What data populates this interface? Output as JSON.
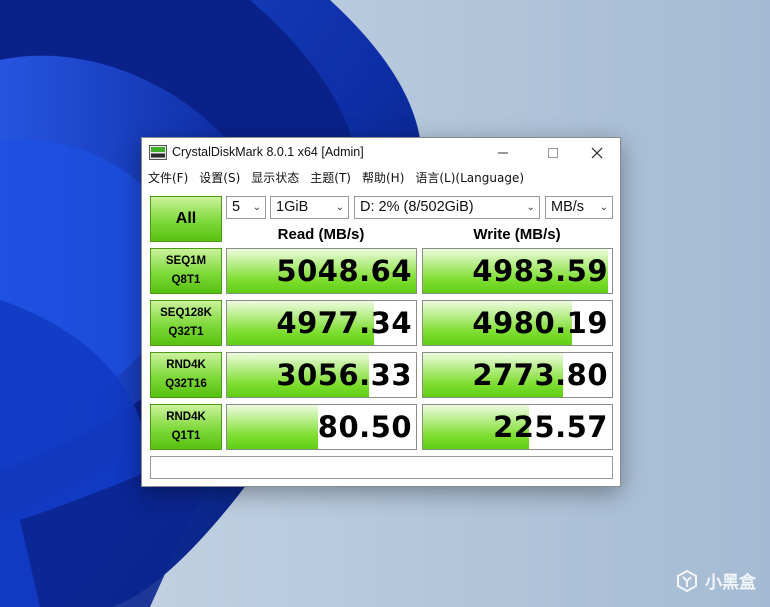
{
  "window": {
    "title": "CrystalDiskMark 8.0.1 x64 [Admin]"
  },
  "menu": [
    "文件(F)",
    "设置(S)",
    "显示状态",
    "主题(T)",
    "帮助(H)",
    "语言(L)(Language)"
  ],
  "controls": {
    "all_label": "All",
    "count": "5",
    "size": "1GiB",
    "drive": "D: 2% (8/502GiB)",
    "unit": "MB/s"
  },
  "headers": {
    "read": "Read (MB/s)",
    "write": "Write (MB/s)"
  },
  "tests": [
    {
      "line1": "SEQ1M",
      "line2": "Q8T1",
      "read": "5048.64",
      "write": "4983.59",
      "read_fill": 1.0,
      "write_fill": 0.98
    },
    {
      "line1": "SEQ128K",
      "line2": "Q32T1",
      "read": "4977.34",
      "write": "4980.19",
      "read_fill": 0.78,
      "write_fill": 0.79
    },
    {
      "line1": "RND4K",
      "line2": "Q32T16",
      "read": "3056.33",
      "write": "2773.80",
      "read_fill": 0.75,
      "write_fill": 0.74
    },
    {
      "line1": "RND4K",
      "line2": "Q1T1",
      "read": "80.50",
      "write": "225.57",
      "read_fill": 0.48,
      "write_fill": 0.56
    }
  ],
  "comment": "",
  "watermark": "小黑盒",
  "colors": {
    "accent_green": "#7fd93a",
    "button_border": "#4c9a16"
  }
}
